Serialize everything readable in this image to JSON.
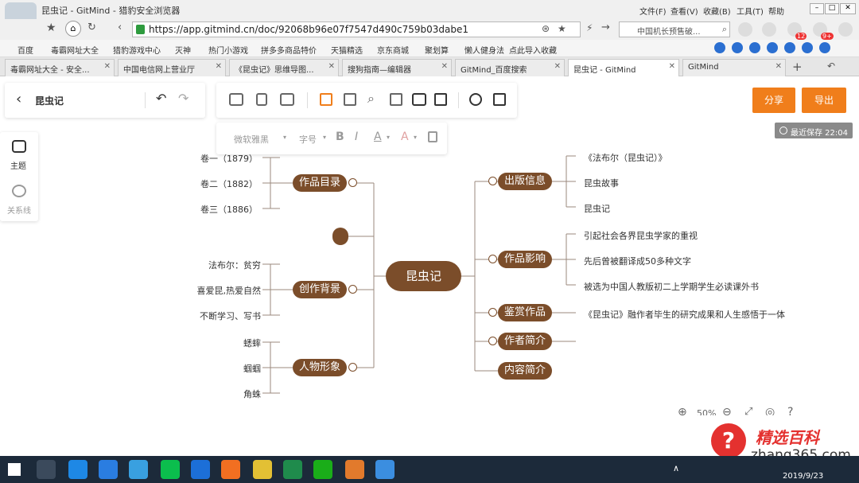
{
  "browser": {
    "title": "昆虫记 - GitMind - 猎豹安全浏览器",
    "menu": [
      "文件(F)",
      "查看(V)",
      "收藏(B)",
      "工具(T)",
      "帮助"
    ],
    "url": "https://app.gitmind.cn/doc/92068b96e07f7547d490c759b03dabe1",
    "search_placeholder": "中国机长预售破...",
    "badge1": "12",
    "badge2": "9+",
    "bookmarks": [
      "百度",
      "毒霸网址大全",
      "猎豹游戏中心",
      "灭神",
      "热门小游戏",
      "拼多多商品特价",
      "天猫精选",
      "京东商城",
      "聚划算",
      "懒人健身法",
      "点此导入收藏"
    ],
    "tabs": [
      "毒霸网址大全 - 安全...",
      "中国电信网上营业厅",
      "《昆虫记》思维导图...",
      "搜狗指南—编辑器",
      "GitMind_百度搜索",
      "昆虫记 - GitMind",
      "GitMind"
    ]
  },
  "app": {
    "doc_title": "昆虫记",
    "share_label": "分享",
    "export_label": "导出",
    "save_status": "最近保存 22:04",
    "font_family": "微软雅黑",
    "font_size": "字号",
    "sidebar": [
      {
        "label": "主题",
        "icon": "theme-icon"
      },
      {
        "label": "关系线",
        "icon": "relation-line-icon"
      }
    ],
    "zoom": "50%"
  },
  "mindmap": {
    "root": "昆虫记",
    "left": [
      {
        "label": "作品目录",
        "children": [
          "卷一（1879）",
          "卷二（1882）",
          "卷三（1886）"
        ]
      },
      {
        "label": "",
        "children": []
      },
      {
        "label": "创作背景",
        "children": [
          "法布尔：贫穷",
          "喜爱昆,热爱自然",
          "不断学习、写书"
        ]
      },
      {
        "label": "人物形象",
        "children": [
          "蟋蟀",
          "蝈蝈",
          "角蛛"
        ]
      }
    ],
    "right": [
      {
        "label": "出版信息",
        "children": [
          "《法布尔（昆虫记）》",
          "昆虫故事",
          "昆虫记"
        ]
      },
      {
        "label": "作品影响",
        "children": [
          "引起社会各界昆虫学家的重视",
          "先后曾被翻译成50多种文字",
          "被选为中国人教版初二上学期学生必读课外书"
        ]
      },
      {
        "label": "鉴赏作品",
        "children": [
          "《昆虫记》融作者毕生的研究成果和人生感悟于一体"
        ]
      },
      {
        "label": "作者简介",
        "children": []
      },
      {
        "label": "内容简介",
        "children": []
      }
    ]
  },
  "watermark": {
    "brand": "精选百科",
    "url": "zhang365.com"
  },
  "taskbar": {
    "date": "2019/9/23"
  },
  "colors": {
    "node": "#7b4d2a",
    "accent": "#f07e1b",
    "line": "#8a7a6e"
  }
}
